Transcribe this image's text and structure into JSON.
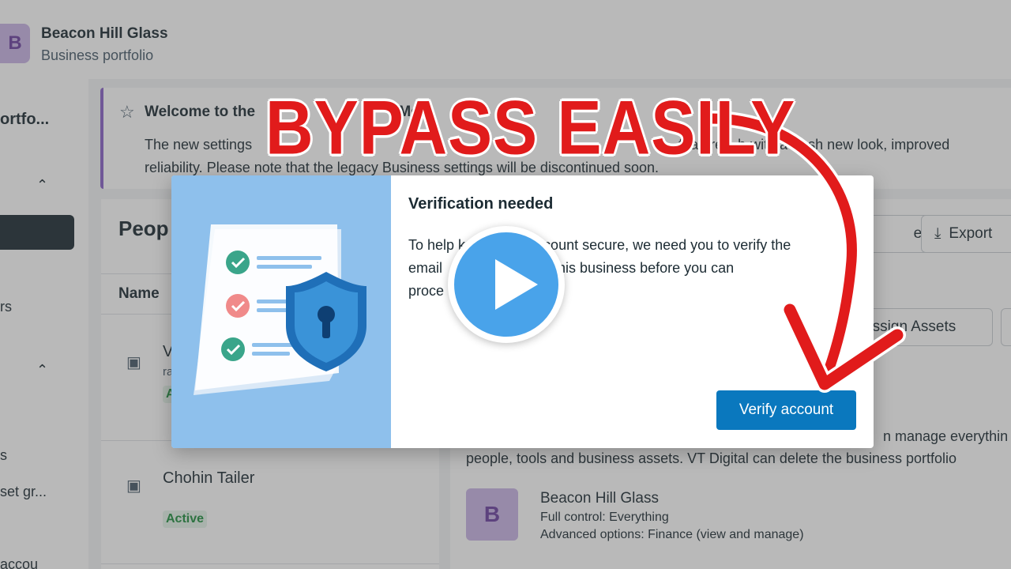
{
  "header": {
    "avatar_letter": "B",
    "business_name": "Beacon Hill Glass",
    "subtitle": "Business portfolio"
  },
  "sidebar": {
    "items": [
      {
        "label": "ortfo..."
      },
      {
        "label": "rs"
      },
      {
        "label": "s"
      },
      {
        "label": "set gr..."
      },
      {
        "label": "accou"
      }
    ],
    "chevron": "⌃"
  },
  "banner": {
    "title": "Welcome to the",
    "title_tail": "Meta",
    "line1_a": "The new settings",
    "line1_b": "features, b",
    "line1_c": "with a fresh new look, improved",
    "line2": "reliability. Please note that the legacy Business settings will be discontinued soon."
  },
  "people": {
    "title": "Peop",
    "column_name": "Name",
    "rows": [
      {
        "name": "V",
        "sub": "ra",
        "status": "A"
      },
      {
        "name": "Chohin Tailer",
        "status": "Active"
      }
    ]
  },
  "detail": {
    "btn_partners": "ers",
    "btn_export": "Export",
    "btn_assign": "Assign Assets",
    "desc_line1": "n manage everythin",
    "desc_line2": "people, tools and business assets. VT Digital can delete the business portfolio",
    "owner": {
      "avatar_letter": "B",
      "name": "Beacon Hill Glass",
      "line1": "Full control: Everything",
      "line2": "Advanced options: Finance (view and manage)"
    }
  },
  "modal": {
    "title": "Verification needed",
    "body_l1a": "To help k",
    "body_l1b": "account secure, we need you to verify the",
    "body_l2a": "email",
    "body_l2b": "e for this business before you can",
    "body_l3": "proce",
    "verify_label": "Verify account"
  },
  "overlay": {
    "headline": "BYPASS EASILY"
  },
  "colors": {
    "accent_blue": "#0a78be",
    "headline_red": "#e11b1b",
    "banner_purple": "#8a63c9",
    "active_green": "#1e8e3e"
  }
}
